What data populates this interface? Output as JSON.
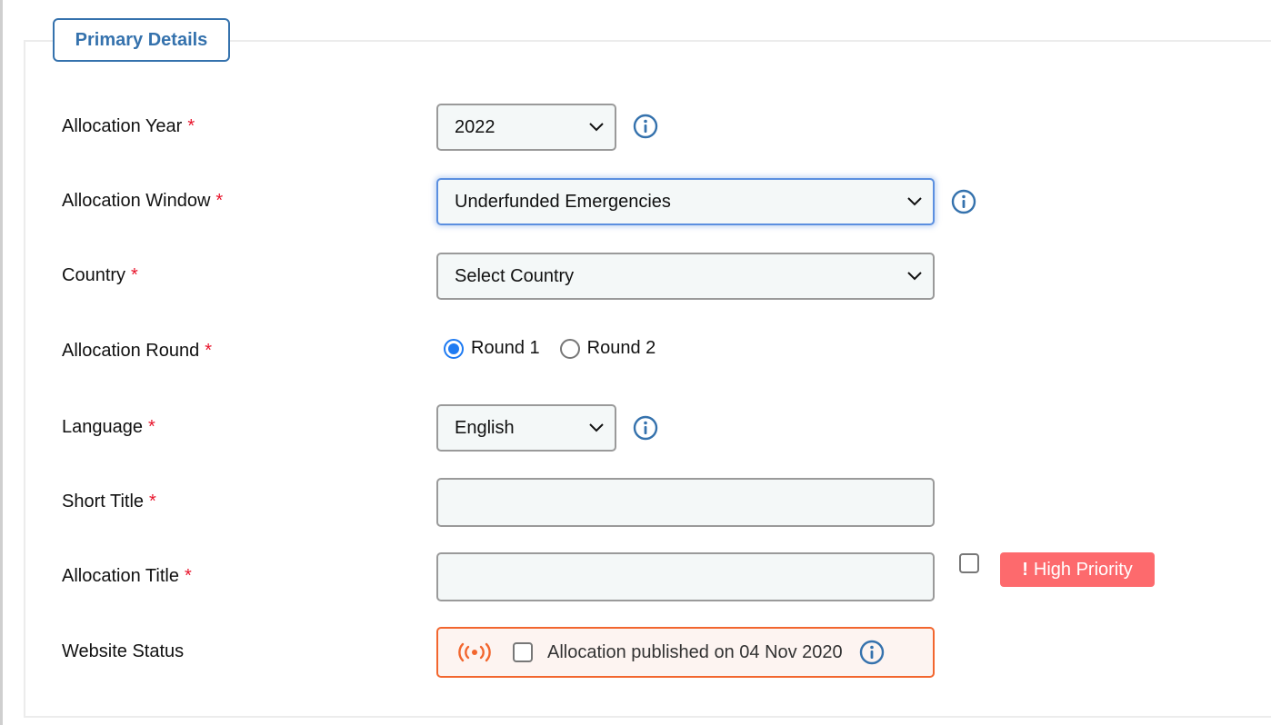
{
  "section": {
    "title": "Primary Details"
  },
  "fields": {
    "allocation_year": {
      "label": "Allocation Year",
      "required_mark": "*",
      "value": "2022"
    },
    "allocation_window": {
      "label": "Allocation Window",
      "required_mark": "*",
      "value": "Underfunded Emergencies"
    },
    "country": {
      "label": "Country",
      "required_mark": "*",
      "value": "Select Country"
    },
    "allocation_round": {
      "label": "Allocation Round",
      "required_mark": "*",
      "options": [
        "Round 1",
        "Round 2"
      ],
      "selected": "Round 1"
    },
    "language": {
      "label": "Language",
      "required_mark": "*",
      "value": "English"
    },
    "short_title": {
      "label": "Short Title",
      "required_mark": "*",
      "value": ""
    },
    "allocation_title": {
      "label": "Allocation Title",
      "required_mark": "*",
      "value": "",
      "priority_label": "High Priority",
      "priority_mark": "!"
    },
    "website_status": {
      "label": "Website Status",
      "text": "Allocation published on 04 Nov 2020"
    }
  },
  "colors": {
    "accent": "#3572ad",
    "required": "#e8142b",
    "priority": "#fd6a6d",
    "status_border": "#f2662e",
    "radio": "#1f7bf2"
  }
}
